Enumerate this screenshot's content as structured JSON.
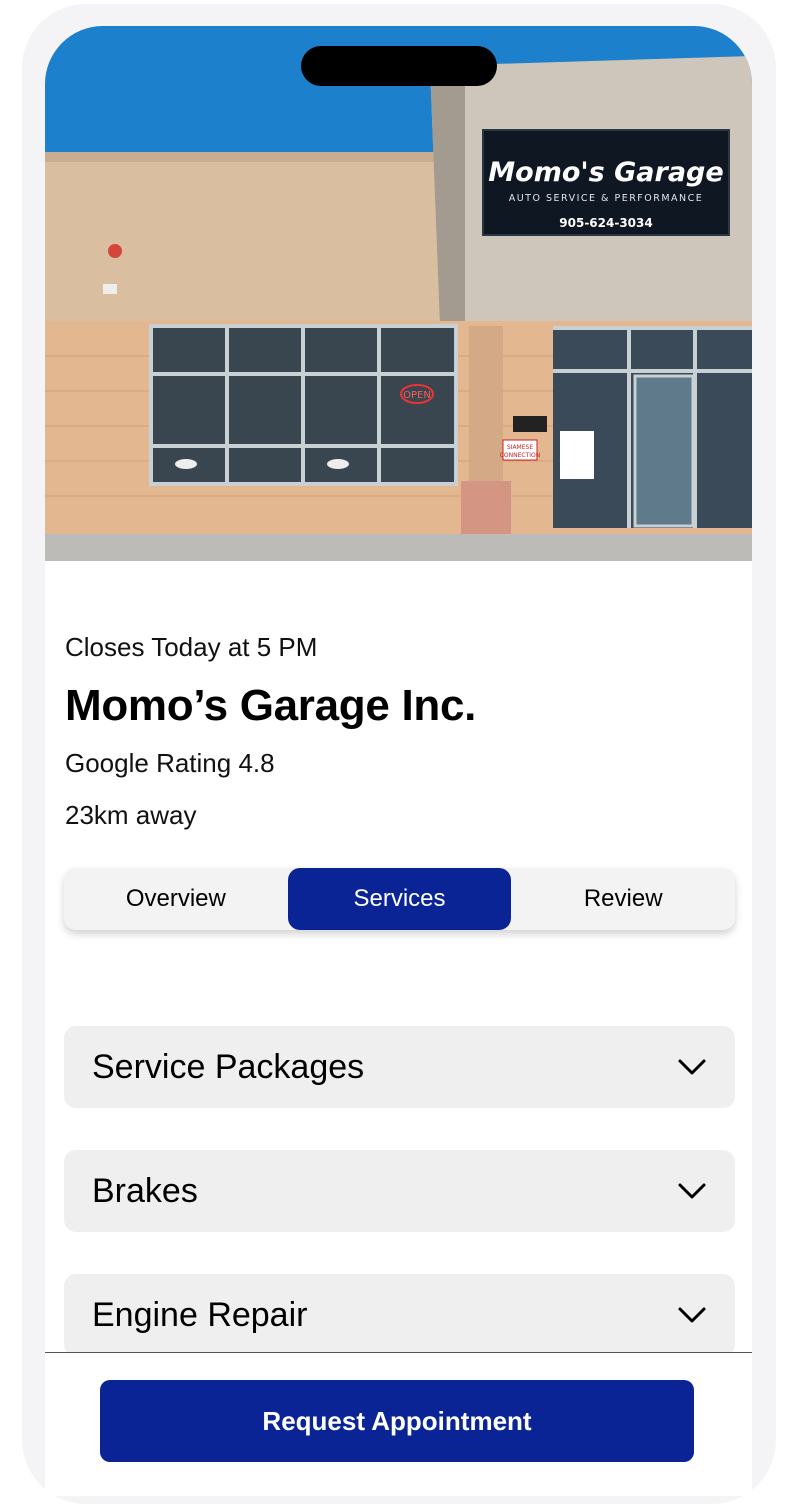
{
  "hero": {
    "sign_title": "Momo's Garage",
    "sign_subtitle": "AUTO SERVICE & PERFORMANCE",
    "sign_phone": "905-624-3034",
    "open_sign": "OPEN",
    "siamese_line1": "SIAMESE",
    "siamese_line2": "CONNECTION"
  },
  "business": {
    "hours": "Closes Today at 5 PM",
    "name": "Momo’s Garage Inc.",
    "rating": "Google Rating 4.8",
    "distance": "23km away"
  },
  "tabs": [
    {
      "label": "Overview",
      "active": false
    },
    {
      "label": "Services",
      "active": true
    },
    {
      "label": "Review",
      "active": false
    }
  ],
  "services": [
    {
      "label": "Service Packages",
      "icon": "chevron-down-icon"
    },
    {
      "label": "Brakes",
      "icon": "chevron-down-icon"
    },
    {
      "label": "Engine Repair",
      "icon": "chevron-down-icon"
    }
  ],
  "cta": {
    "label": "Request Appointment"
  },
  "colors": {
    "accent": "#0a2496",
    "panel": "#efefef",
    "text": "#000000"
  }
}
